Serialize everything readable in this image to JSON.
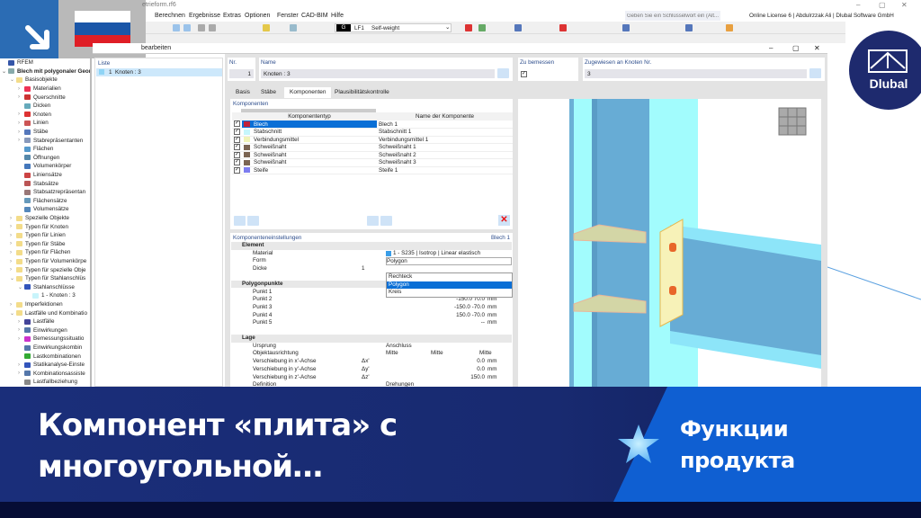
{
  "window": {
    "title": "etrieform.rf6",
    "dialog_title": "bearbeiten"
  },
  "menu": [
    "Berechnen",
    "Ergebnisse",
    "Extras",
    "Optionen",
    "Fenster",
    "CAD-BIM",
    "Hilfe"
  ],
  "search": {
    "placeholder": "Geben Sie ein Schlüsselwort ein (Alt..."
  },
  "license": "Online License 6 | Abdulrzzak Ali | Dlubal Software GmbH",
  "loadcase": {
    "badge": "G",
    "id": "LF1",
    "name": "Self-weight"
  },
  "tree": [
    {
      "label": "RFEM",
      "level": 0,
      "exp": "",
      "icon": "#3556a8"
    },
    {
      "label": "Blech mit polygonaler Geom",
      "level": 0,
      "exp": "v",
      "icon": "#8aa",
      "bold": true
    },
    {
      "label": "Basisobjekte",
      "level": 1,
      "exp": "v",
      "icon": "#f3dc8a"
    },
    {
      "label": "Materialien",
      "level": 2,
      "exp": ">",
      "icon": "#e35"
    },
    {
      "label": "Querschnitte",
      "level": 2,
      "exp": ">",
      "icon": "#c33"
    },
    {
      "label": "Dicken",
      "level": 2,
      "exp": "",
      "icon": "#6ab"
    },
    {
      "label": "Knoten",
      "level": 2,
      "exp": ">",
      "icon": "#d33"
    },
    {
      "label": "Linien",
      "level": 2,
      "exp": ">",
      "icon": "#c55"
    },
    {
      "label": "Stäbe",
      "level": 2,
      "exp": ">",
      "icon": "#57b"
    },
    {
      "label": "Stabrepräsentanten",
      "level": 2,
      "exp": ">",
      "icon": "#89b"
    },
    {
      "label": "Flächen",
      "level": 2,
      "exp": "",
      "icon": "#59c"
    },
    {
      "label": "Öffnungen",
      "level": 2,
      "exp": "",
      "icon": "#58a"
    },
    {
      "label": "Volumenkörper",
      "level": 2,
      "exp": "",
      "icon": "#47b"
    },
    {
      "label": "Liniensätze",
      "level": 2,
      "exp": "",
      "icon": "#c44"
    },
    {
      "label": "Stabsätze",
      "level": 2,
      "exp": "",
      "icon": "#b55"
    },
    {
      "label": "Stabsatzrepräsentan",
      "level": 2,
      "exp": "",
      "icon": "#977"
    },
    {
      "label": "Flächensätze",
      "level": 2,
      "exp": "",
      "icon": "#69b"
    },
    {
      "label": "Volumensätze",
      "level": 2,
      "exp": "",
      "icon": "#58b"
    },
    {
      "label": "Spezielle Objekte",
      "level": 1,
      "exp": ">",
      "icon": "#f3dc8a"
    },
    {
      "label": "Typen für Knoten",
      "level": 1,
      "exp": ">",
      "icon": "#f3dc8a"
    },
    {
      "label": "Typen für Linien",
      "level": 1,
      "exp": ">",
      "icon": "#f3dc8a"
    },
    {
      "label": "Typen für Stäbe",
      "level": 1,
      "exp": ">",
      "icon": "#f3dc8a"
    },
    {
      "label": "Typen für Flächen",
      "level": 1,
      "exp": ">",
      "icon": "#f3dc8a"
    },
    {
      "label": "Typen für Volumenkörpe",
      "level": 1,
      "exp": ">",
      "icon": "#f3dc8a"
    },
    {
      "label": "Typen für spezielle Obje",
      "level": 1,
      "exp": ">",
      "icon": "#f3dc8a"
    },
    {
      "label": "Typen für Stahlanschlüs",
      "level": 1,
      "exp": "v",
      "icon": "#f3dc8a"
    },
    {
      "label": "Stahlanschlüsse",
      "level": 2,
      "exp": "v",
      "icon": "#35b"
    },
    {
      "label": "1 - Knoten : 3",
      "level": 3,
      "exp": "",
      "icon": "#c8f4fb"
    },
    {
      "label": "Imperfektionen",
      "level": 1,
      "exp": ">",
      "icon": "#f3dc8a"
    },
    {
      "label": "Lastfälle und Kombinatio",
      "level": 1,
      "exp": "v",
      "icon": "#f3dc8a"
    },
    {
      "label": "Lastfälle",
      "level": 2,
      "exp": ">",
      "icon": "#449"
    },
    {
      "label": "Einwirkungen",
      "level": 2,
      "exp": ">",
      "icon": "#57a"
    },
    {
      "label": "Bemessungssituatio",
      "level": 2,
      "exp": ">",
      "icon": "#c3c"
    },
    {
      "label": "Einwirkungskombin",
      "level": 2,
      "exp": "",
      "icon": "#57a"
    },
    {
      "label": "Lastkombinationen",
      "level": 2,
      "exp": "",
      "icon": "#3a3"
    },
    {
      "label": "Statikanalyse-Einste",
      "level": 2,
      "exp": ">",
      "icon": "#35b"
    },
    {
      "label": "Kombinationsassiste",
      "level": 2,
      "exp": ">",
      "icon": "#57a"
    },
    {
      "label": "Lastfallbeziehung",
      "level": 2,
      "exp": "",
      "icon": "#888"
    }
  ],
  "list": {
    "header": "Liste",
    "items": [
      {
        "no": "1",
        "label": "Knoten : 3"
      }
    ]
  },
  "header": {
    "nr_label": "Nr.",
    "nr_value": "1",
    "name_label": "Name",
    "name_value": "Knoten : 3",
    "design_label": "Zu bemessen",
    "design_checked": true,
    "assigned_label": "Zugewiesen an Knoten Nr.",
    "assigned_value": "3"
  },
  "tabs": [
    "Basis",
    "Stäbe",
    "Komponenten",
    "Plausibilitätskontrolle"
  ],
  "active_tab": 2,
  "components": {
    "title": "Komponenten",
    "col_type": "Komponententyp",
    "col_name": "Name der Komponente",
    "rows": [
      {
        "type": "Blech",
        "name": "Blech 1",
        "color": "#c0223a",
        "selected": true
      },
      {
        "type": "Stabschnitt",
        "name": "Stabschnitt 1",
        "color": "#c6f6fb"
      },
      {
        "type": "Verbindungsmittel",
        "name": "Verbindungsmittel 1",
        "color": "#f0f3b8"
      },
      {
        "type": "Schweißnaht",
        "name": "Schweißnaht 1",
        "color": "#7a6452"
      },
      {
        "type": "Schweißnaht",
        "name": "Schweißnaht 2",
        "color": "#7a6452"
      },
      {
        "type": "Schweißnaht",
        "name": "Schweißnaht 3",
        "color": "#7a6452"
      },
      {
        "type": "Steife",
        "name": "Steife 1",
        "color": "#7d7df0"
      }
    ]
  },
  "settings": {
    "title": "Komponenteneinstellungen",
    "current": "Blech 1",
    "element": {
      "label": "Element",
      "material_label": "Material",
      "material_value": "1 - S235 | Isotrop | Linear elastisch",
      "form_label": "Form",
      "form_value": "Polygon",
      "thickness_label": "Dicke",
      "thickness_symbol": "t",
      "thickness_value": "1"
    },
    "form_options": [
      "Rechteck",
      "Polygon",
      "Kreis"
    ],
    "polygon": {
      "label": "Polygonpunkte",
      "unit": "mm",
      "points": [
        {
          "label": "Punkt 1",
          "value": "150.0 70.0"
        },
        {
          "label": "Punkt 2",
          "value": "-150.0 70.0"
        },
        {
          "label": "Punkt 3",
          "value": "-150.0 -70.0"
        },
        {
          "label": "Punkt 4",
          "value": "150.0 -70.0"
        },
        {
          "label": "Punkt 5",
          "value": "--"
        }
      ]
    },
    "position": {
      "label": "Lage",
      "origin_label": "Ursprung",
      "origin_value": "Anschluss",
      "orient_label": "Objektausrichtung",
      "orient_values": [
        "Mitte",
        "Mitte",
        "Mitte"
      ],
      "shifts": [
        {
          "label": "Verschiebung in x'-Achse",
          "sym": "Δx'",
          "value": "0.0"
        },
        {
          "label": "Verschiebung in y'-Achse",
          "sym": "Δy'",
          "value": "0.0"
        },
        {
          "label": "Verschiebung in z'-Achse",
          "sym": "Δz'",
          "value": "150.0"
        }
      ],
      "def_label": "Definition",
      "def_value": "Drehungen",
      "unit": "mm"
    }
  },
  "brand": {
    "name": "Dlubal"
  },
  "banner": {
    "title_line1": "Компонент «плита» с",
    "title_line2": "многоугольной…",
    "tag_line1": "Функции",
    "tag_line2": "продукта"
  }
}
